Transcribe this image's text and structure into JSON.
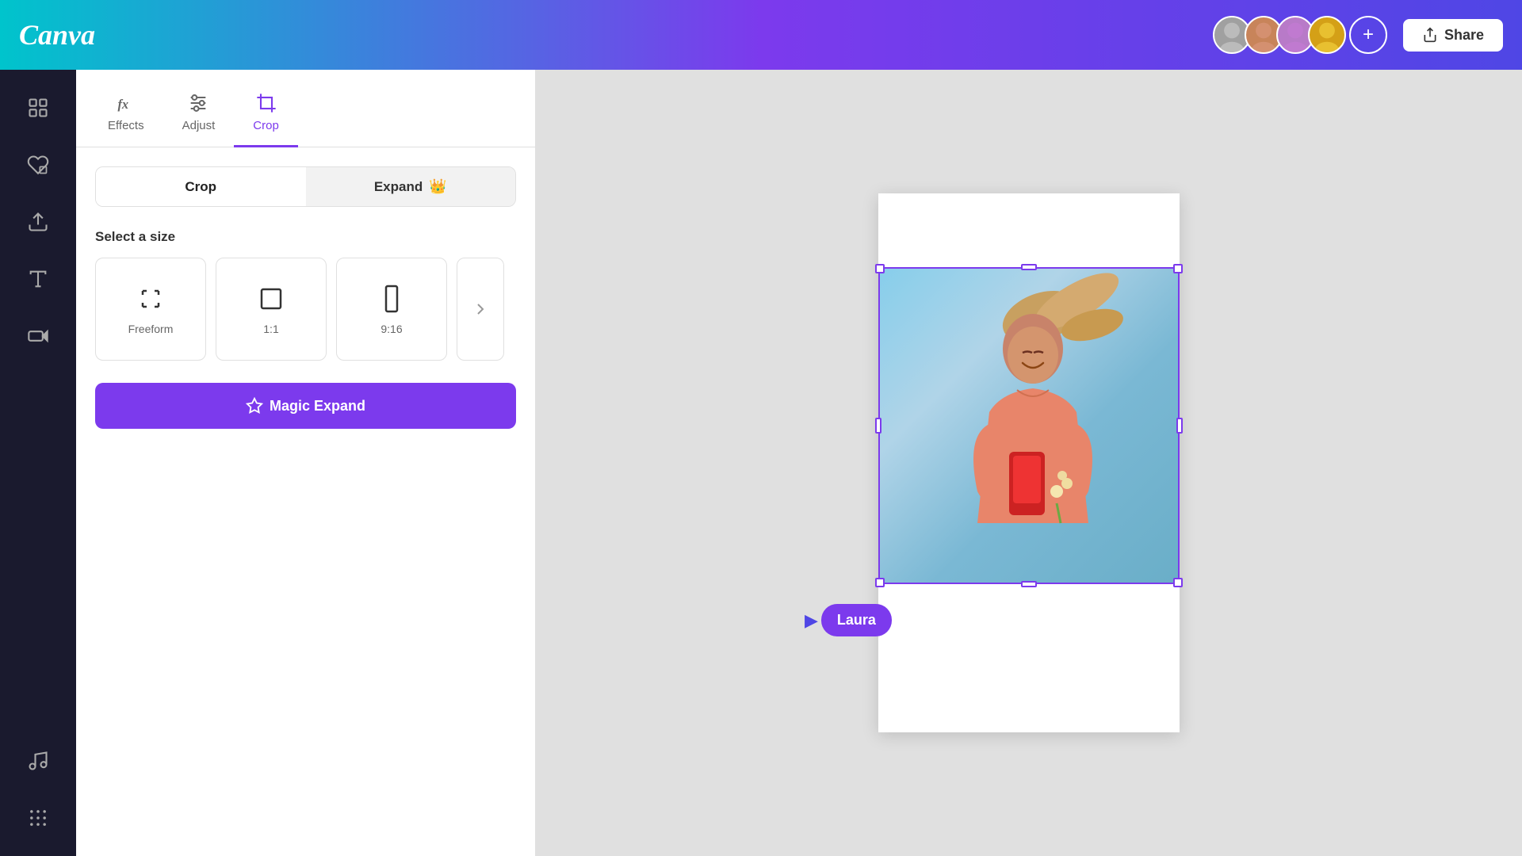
{
  "header": {
    "logo": "Canva",
    "share_label": "Share",
    "add_collaborator_label": "+"
  },
  "sidebar": {
    "items": [
      {
        "id": "elements",
        "label": "Elements",
        "icon": "grid-icon"
      },
      {
        "id": "templates",
        "label": "Templates",
        "icon": "heart-icon"
      },
      {
        "id": "uploads",
        "label": "Uploads",
        "icon": "upload-icon"
      },
      {
        "id": "text",
        "label": "Text",
        "icon": "text-icon"
      },
      {
        "id": "video",
        "label": "Video",
        "icon": "video-icon"
      },
      {
        "id": "music",
        "label": "Music",
        "icon": "music-icon"
      },
      {
        "id": "more",
        "label": "More",
        "icon": "grid-dots-icon"
      }
    ]
  },
  "panel": {
    "tabs": [
      {
        "id": "effects",
        "label": "Effects",
        "active": false
      },
      {
        "id": "adjust",
        "label": "Adjust",
        "active": false
      },
      {
        "id": "crop",
        "label": "Crop",
        "active": true
      }
    ],
    "toggle": {
      "crop_label": "Crop",
      "expand_label": "Expand",
      "expand_crown": "👑"
    },
    "section_title": "Select a size",
    "size_options": [
      {
        "id": "freeform",
        "label": "Freeform"
      },
      {
        "id": "1:1",
        "label": "1:1"
      },
      {
        "id": "9:16",
        "label": "9:16"
      }
    ],
    "magic_expand_label": "Magic Expand"
  },
  "canvas": {
    "collaborator_name": "Laura",
    "cursor_icon": "▶"
  }
}
